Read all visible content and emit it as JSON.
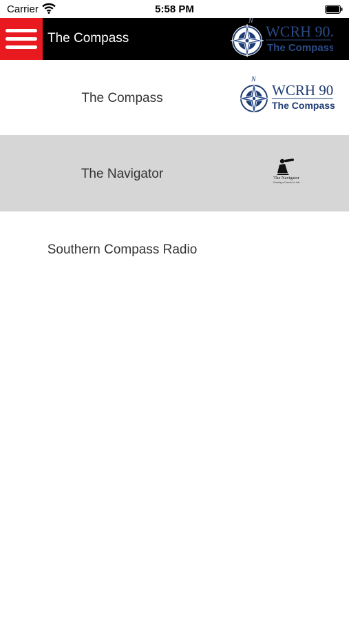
{
  "status_bar": {
    "carrier": "Carrier",
    "time": "5:58 PM",
    "wifi_icon": "wifi-icon",
    "battery_icon": "battery-icon"
  },
  "nav_bar": {
    "menu_icon": "hamburger-menu-icon",
    "title": "The Compass",
    "logo": {
      "brand": "WCRH 90.5",
      "tagline": "The Compass",
      "mark": "N",
      "icon": "compass-rose-icon"
    }
  },
  "stations": [
    {
      "name": "The Compass",
      "selected": false,
      "logo": {
        "brand": "WCRH 90.5",
        "tagline": "The Compass",
        "mark": "N",
        "icon": "compass-rose-icon"
      }
    },
    {
      "name": "The Navigator",
      "selected": true,
      "logo": {
        "brand": "The Navigator",
        "tagline": "Charting a Course for Life",
        "icon": "navigator-silhouette-icon"
      }
    },
    {
      "name": "Southern Compass Radio",
      "selected": false
    }
  ],
  "colors": {
    "menu_button": "#e8191f",
    "nav_bar": "#000000",
    "selected_row": "#d6d6d6",
    "logo_blue": "#1e3b73"
  }
}
